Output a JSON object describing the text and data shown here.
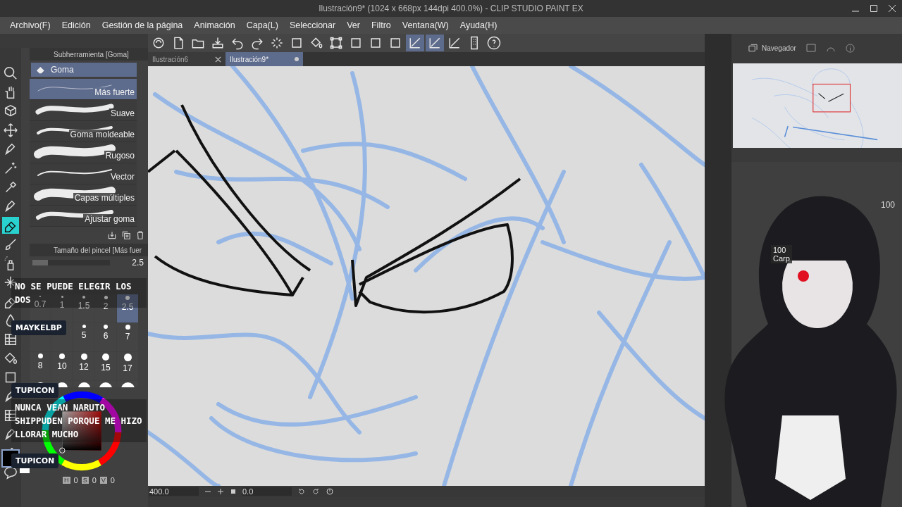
{
  "window": {
    "title": "Ilustración9* (1024 x 668px 144dpi 400.0%) - CLIP STUDIO PAINT EX"
  },
  "menu": [
    "Archivo(F)",
    "Edición",
    "Gestión de la página",
    "Animación",
    "Capa(L)",
    "Seleccionar",
    "Ver",
    "Filtro",
    "Ventana(W)",
    "Ayuda(H)"
  ],
  "command_bar": [
    {
      "kind": "cloud",
      "selected": false
    },
    {
      "kind": "new",
      "selected": false
    },
    {
      "kind": "open",
      "selected": false
    },
    {
      "kind": "export",
      "selected": false
    },
    {
      "kind": "undo",
      "selected": false
    },
    {
      "kind": "redo",
      "selected": false
    },
    {
      "kind": "spinner",
      "selected": false
    },
    {
      "kind": "square",
      "selected": false
    },
    {
      "kind": "fill",
      "selected": false
    },
    {
      "kind": "transform",
      "selected": false
    },
    {
      "kind": "square",
      "selected": false
    },
    {
      "kind": "square",
      "selected": false
    },
    {
      "kind": "square",
      "selected": false
    },
    {
      "kind": "ruler",
      "selected": true
    },
    {
      "kind": "ruler",
      "selected": true
    },
    {
      "kind": "ruler",
      "selected": false
    },
    {
      "kind": "device",
      "selected": false
    },
    {
      "kind": "help",
      "selected": false
    }
  ],
  "tools": [
    {
      "kind": "zoom",
      "selected": false
    },
    {
      "kind": "hand",
      "selected": false
    },
    {
      "kind": "cube",
      "selected": false
    },
    {
      "kind": "move",
      "selected": false
    },
    {
      "kind": "pen",
      "selected": false
    },
    {
      "kind": "wand",
      "selected": false
    },
    {
      "kind": "dropper",
      "selected": false
    },
    {
      "kind": "pen",
      "selected": false
    },
    {
      "kind": "eraser",
      "selected": true
    },
    {
      "kind": "brush",
      "selected": false
    },
    {
      "kind": "spray",
      "selected": false
    },
    {
      "kind": "sparkle",
      "selected": false
    },
    {
      "kind": "eraser",
      "selected": false
    },
    {
      "kind": "drop",
      "selected": false
    },
    {
      "kind": "grid",
      "selected": false
    },
    {
      "kind": "fill",
      "selected": false
    },
    {
      "kind": "square",
      "selected": false
    },
    {
      "kind": "pen",
      "selected": false
    },
    {
      "kind": "grid",
      "selected": false
    },
    {
      "kind": "pen",
      "selected": false
    },
    {
      "kind": "pen",
      "selected": false
    },
    {
      "kind": "bubble",
      "selected": false
    }
  ],
  "subtool_panel": {
    "title": "Subherramienta [Goma]",
    "group": "Goma",
    "items": [
      {
        "name": "Más fuerte",
        "selected": true
      },
      {
        "name": "Suave",
        "selected": false
      },
      {
        "name": "Goma moldeable",
        "selected": false
      },
      {
        "name": "Rugoso",
        "selected": false
      },
      {
        "name": "Vector",
        "selected": false
      },
      {
        "name": "Capas múltiples",
        "selected": false
      },
      {
        "name": "Ajustar goma",
        "selected": false
      }
    ]
  },
  "brush_size": {
    "title": "Tamaño del pincel [Más fuer",
    "value": "2.5",
    "level": 0.2,
    "presets": [
      {
        "label": "0.7",
        "selected": false
      },
      {
        "label": "1",
        "selected": false
      },
      {
        "label": "1.5",
        "selected": false
      },
      {
        "label": "2",
        "selected": false
      },
      {
        "label": "2.5",
        "selected": true
      },
      {
        "selected": false
      },
      {
        "selected": false
      },
      {
        "label": "5",
        "selected": false
      },
      {
        "label": "6",
        "selected": false
      },
      {
        "label": "7",
        "selected": false
      },
      {
        "label": "8",
        "selected": false
      },
      {
        "label": "10",
        "selected": false
      },
      {
        "label": "12",
        "selected": false
      },
      {
        "label": "15",
        "selected": false
      },
      {
        "label": "17",
        "selected": false
      },
      {
        "selected": false
      },
      {
        "selected": false
      },
      {
        "selected": false
      },
      {
        "selected": false
      },
      {
        "selected": false
      }
    ]
  },
  "color": {
    "values": [
      {
        "label": "H",
        "value": "0"
      },
      {
        "label": "S",
        "value": "0"
      },
      {
        "label": "V",
        "value": "0"
      }
    ]
  },
  "canvas_tabs": [
    {
      "label": "Ilustración6",
      "selected": false
    },
    {
      "label": "Ilustración9*",
      "selected": true
    }
  ],
  "navigator": {
    "title": "Navegador"
  },
  "layers": {
    "opacity": "100",
    "row_opacity": "100",
    "row_name": "Carp"
  },
  "status": {
    "zoom": "400.0",
    "angle": "0.0"
  },
  "chat": [
    {
      "kind": "message",
      "text": "NO SE PUEDE ELEGIR LOS DOS"
    },
    {
      "kind": "name",
      "text": "MAYKELBP"
    },
    {
      "kind": "name",
      "text": "TUPICON"
    },
    {
      "kind": "message",
      "text": "NUNCA VEAN NARUTO SHIPPUDEN PORQUE ME HIZO LLORAR MUCHO"
    },
    {
      "kind": "name",
      "text": "TUPICON"
    }
  ]
}
